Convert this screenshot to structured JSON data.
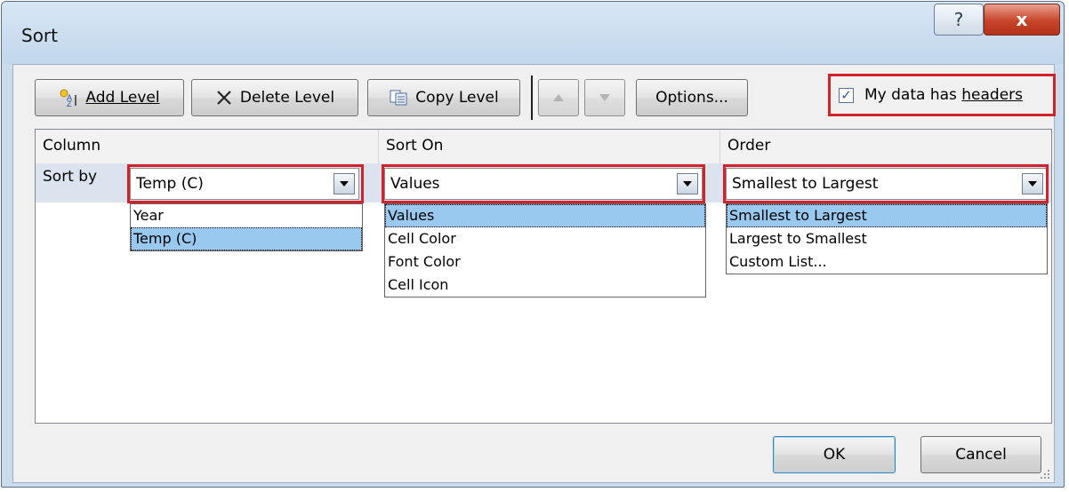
{
  "window": {
    "title": "Sort",
    "help_glyph": "?",
    "close_glyph": "x"
  },
  "toolbar": {
    "add_level_label": "Add Level",
    "delete_level_label": "Delete Level",
    "copy_level_label": "Copy Level",
    "options_label": "Options...",
    "has_headers_label": "My data has headers",
    "has_headers_checked": true
  },
  "grid": {
    "headers": [
      "Column",
      "Sort On",
      "Order"
    ],
    "sort_by_label": "Sort by",
    "column": {
      "selected": "Temp (C)",
      "options": [
        "Year",
        "Temp (C)"
      ],
      "highlighted": "Temp (C)"
    },
    "sort_on": {
      "selected": "Values",
      "options": [
        "Values",
        "Cell Color",
        "Font Color",
        "Cell Icon"
      ],
      "highlighted": "Values"
    },
    "order": {
      "selected": "Smallest to Largest",
      "options": [
        "Smallest to Largest",
        "Largest to Smallest",
        "Custom List..."
      ],
      "highlighted": "Smallest to Largest"
    }
  },
  "footer": {
    "ok_label": "OK",
    "cancel_label": "Cancel"
  },
  "colors": {
    "highlight_box": "#d2232a",
    "selected_item": "#99c9ef",
    "dialog_bg": "#f0f0f0",
    "frame": "#c9dcee"
  },
  "icons": [
    "add-level-icon",
    "delete-x-icon",
    "copy-level-icon",
    "move-up-icon",
    "move-down-icon",
    "help-icon",
    "close-icon",
    "dropdown-arrow-icon",
    "resize-grip-icon"
  ]
}
